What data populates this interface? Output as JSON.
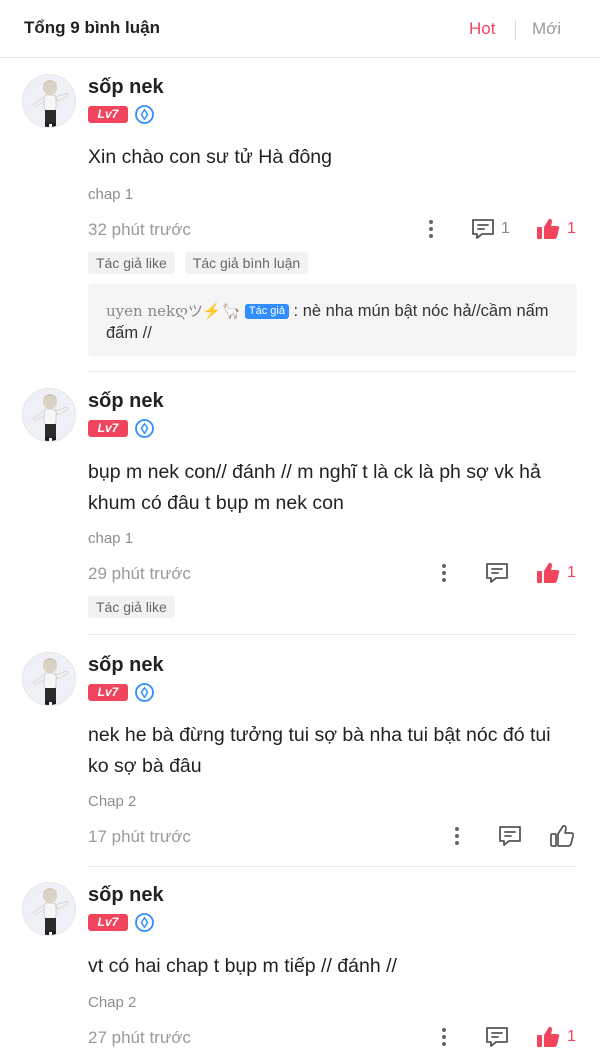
{
  "header": {
    "title": "Tổng 9 bình luận",
    "sort_hot": "Hot",
    "sort_new": "Mới"
  },
  "colors": {
    "accent": "#f0455d",
    "level_badge": "#f0455d",
    "verified": "#2f8dff"
  },
  "comments": [
    {
      "username": "sốp nek",
      "level": "Lv7",
      "content": "Xin chào con sư tử Hà đông",
      "chap": "chap 1",
      "time": "32 phút trước",
      "reply_count": "1",
      "like_count": "1",
      "liked": true,
      "tags": [
        "Tác giả like",
        "Tác giả bình luận"
      ],
      "reply": {
        "name": "uyen nekღツ⚡🦙",
        "badge": "Tác giả",
        "text": " : nè nha mún bật nóc hả//cầm nấm đấm //"
      }
    },
    {
      "username": "sốp nek",
      "level": "Lv7",
      "content": "bụp m nek con// đánh // m nghĩ t là ck là ph sợ vk hả khum có đâu t bụp m nek con",
      "chap": "chap 1",
      "time": "29 phút trước",
      "like_count": "1",
      "liked": true,
      "tags": [
        "Tác giả like"
      ]
    },
    {
      "username": "sốp nek",
      "level": "Lv7",
      "content": "nek he bà đừng tưởng tui sợ bà nha tui bật nóc đó tui ko sợ bà đâu",
      "chap": "Chap 2",
      "time": "17 phút trước",
      "liked": false
    },
    {
      "username": "sốp nek",
      "level": "Lv7",
      "content": "vt có hai chap t bụp m tiếp // đánh //",
      "chap": "Chap 2",
      "time": "27 phút trước",
      "like_count": "1",
      "liked": true
    }
  ]
}
